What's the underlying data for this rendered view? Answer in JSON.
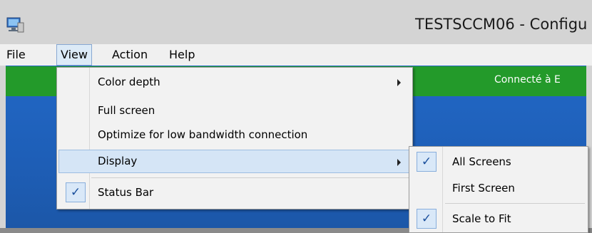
{
  "window": {
    "title": "TESTSCCM06 - Configu"
  },
  "menubar": {
    "items": [
      {
        "label": "File"
      },
      {
        "label": "View"
      },
      {
        "label": "Action"
      },
      {
        "label": "Help"
      }
    ]
  },
  "status": {
    "text": "Connecté à E"
  },
  "view_menu": {
    "items": [
      {
        "label": "Color depth"
      },
      {
        "label": "Full screen"
      },
      {
        "label": "Optimize for low bandwidth connection"
      },
      {
        "label": "Display"
      },
      {
        "label": "Status Bar",
        "checked": true
      }
    ]
  },
  "display_menu": {
    "items": [
      {
        "label": "All Screens",
        "checked": true
      },
      {
        "label": "First Screen",
        "checked": false
      },
      {
        "label": "Scale to Fit",
        "checked": true
      }
    ]
  },
  "glyphs": {
    "check": "✓"
  }
}
